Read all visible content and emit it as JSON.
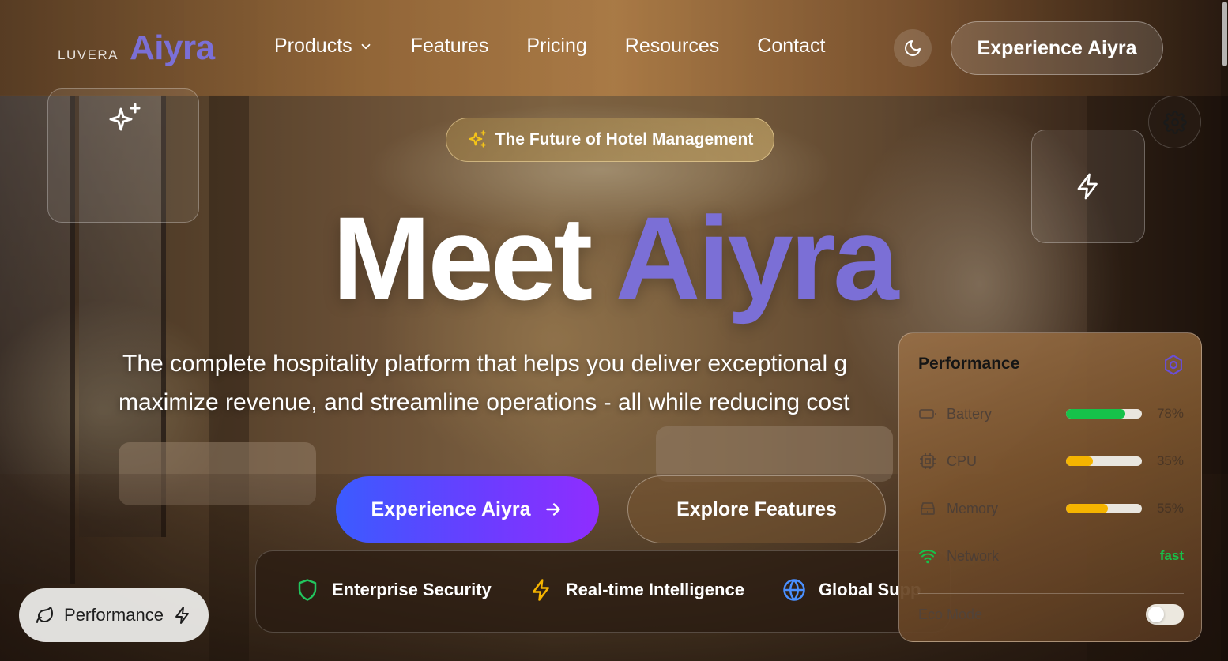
{
  "brand": {
    "sub": "LUVERA",
    "name": "Aiyra"
  },
  "nav": {
    "items": [
      {
        "label": "Products",
        "dropdown": true
      },
      {
        "label": "Features"
      },
      {
        "label": "Pricing"
      },
      {
        "label": "Resources"
      },
      {
        "label": "Contact"
      }
    ],
    "theme_toggle_icon": "moon-icon",
    "cta_label": "Experience Aiyra"
  },
  "hero": {
    "badge_label": "The Future of Hotel Management",
    "badge_icon": "sparkles-icon",
    "title_part1": "Meet",
    "title_part2": "Aiyra",
    "description_line1": "The complete hospitality platform that helps you deliver exceptional g",
    "description_line2": "maximize revenue, and streamline operations - all while reducing cost",
    "primary_button": "Experience Aiyra",
    "secondary_button": "Explore Features"
  },
  "features": [
    {
      "label": "Enterprise Security",
      "icon": "shield-icon",
      "color": "#22c55e"
    },
    {
      "label": "Real-time Intelligence",
      "icon": "bolt-icon",
      "color": "#f5b400"
    },
    {
      "label": "Global Supp",
      "icon": "globe-icon",
      "color": "#4a90ff"
    }
  ],
  "performance_pill": {
    "label": "Performance"
  },
  "performance_panel": {
    "title": "Performance",
    "metrics": [
      {
        "label": "Battery",
        "value": "78%",
        "fill": 0.78,
        "color": "#16c24a",
        "icon": "battery-icon"
      },
      {
        "label": "CPU",
        "value": "35%",
        "fill": 0.35,
        "color": "#f5b400",
        "icon": "cpu-icon"
      },
      {
        "label": "Memory",
        "value": "55%",
        "fill": 0.55,
        "color": "#f5b400",
        "icon": "memory-icon"
      },
      {
        "label": "Network",
        "value": "fast",
        "icon": "wifi-icon",
        "color": "#16c24a"
      }
    ],
    "eco_mode_label": "Eco Mode",
    "eco_mode_on": false
  },
  "colors": {
    "accent": "#7b6fd6",
    "primary_gradient_start": "#3b5bff",
    "primary_gradient_end": "#8f2dff"
  }
}
